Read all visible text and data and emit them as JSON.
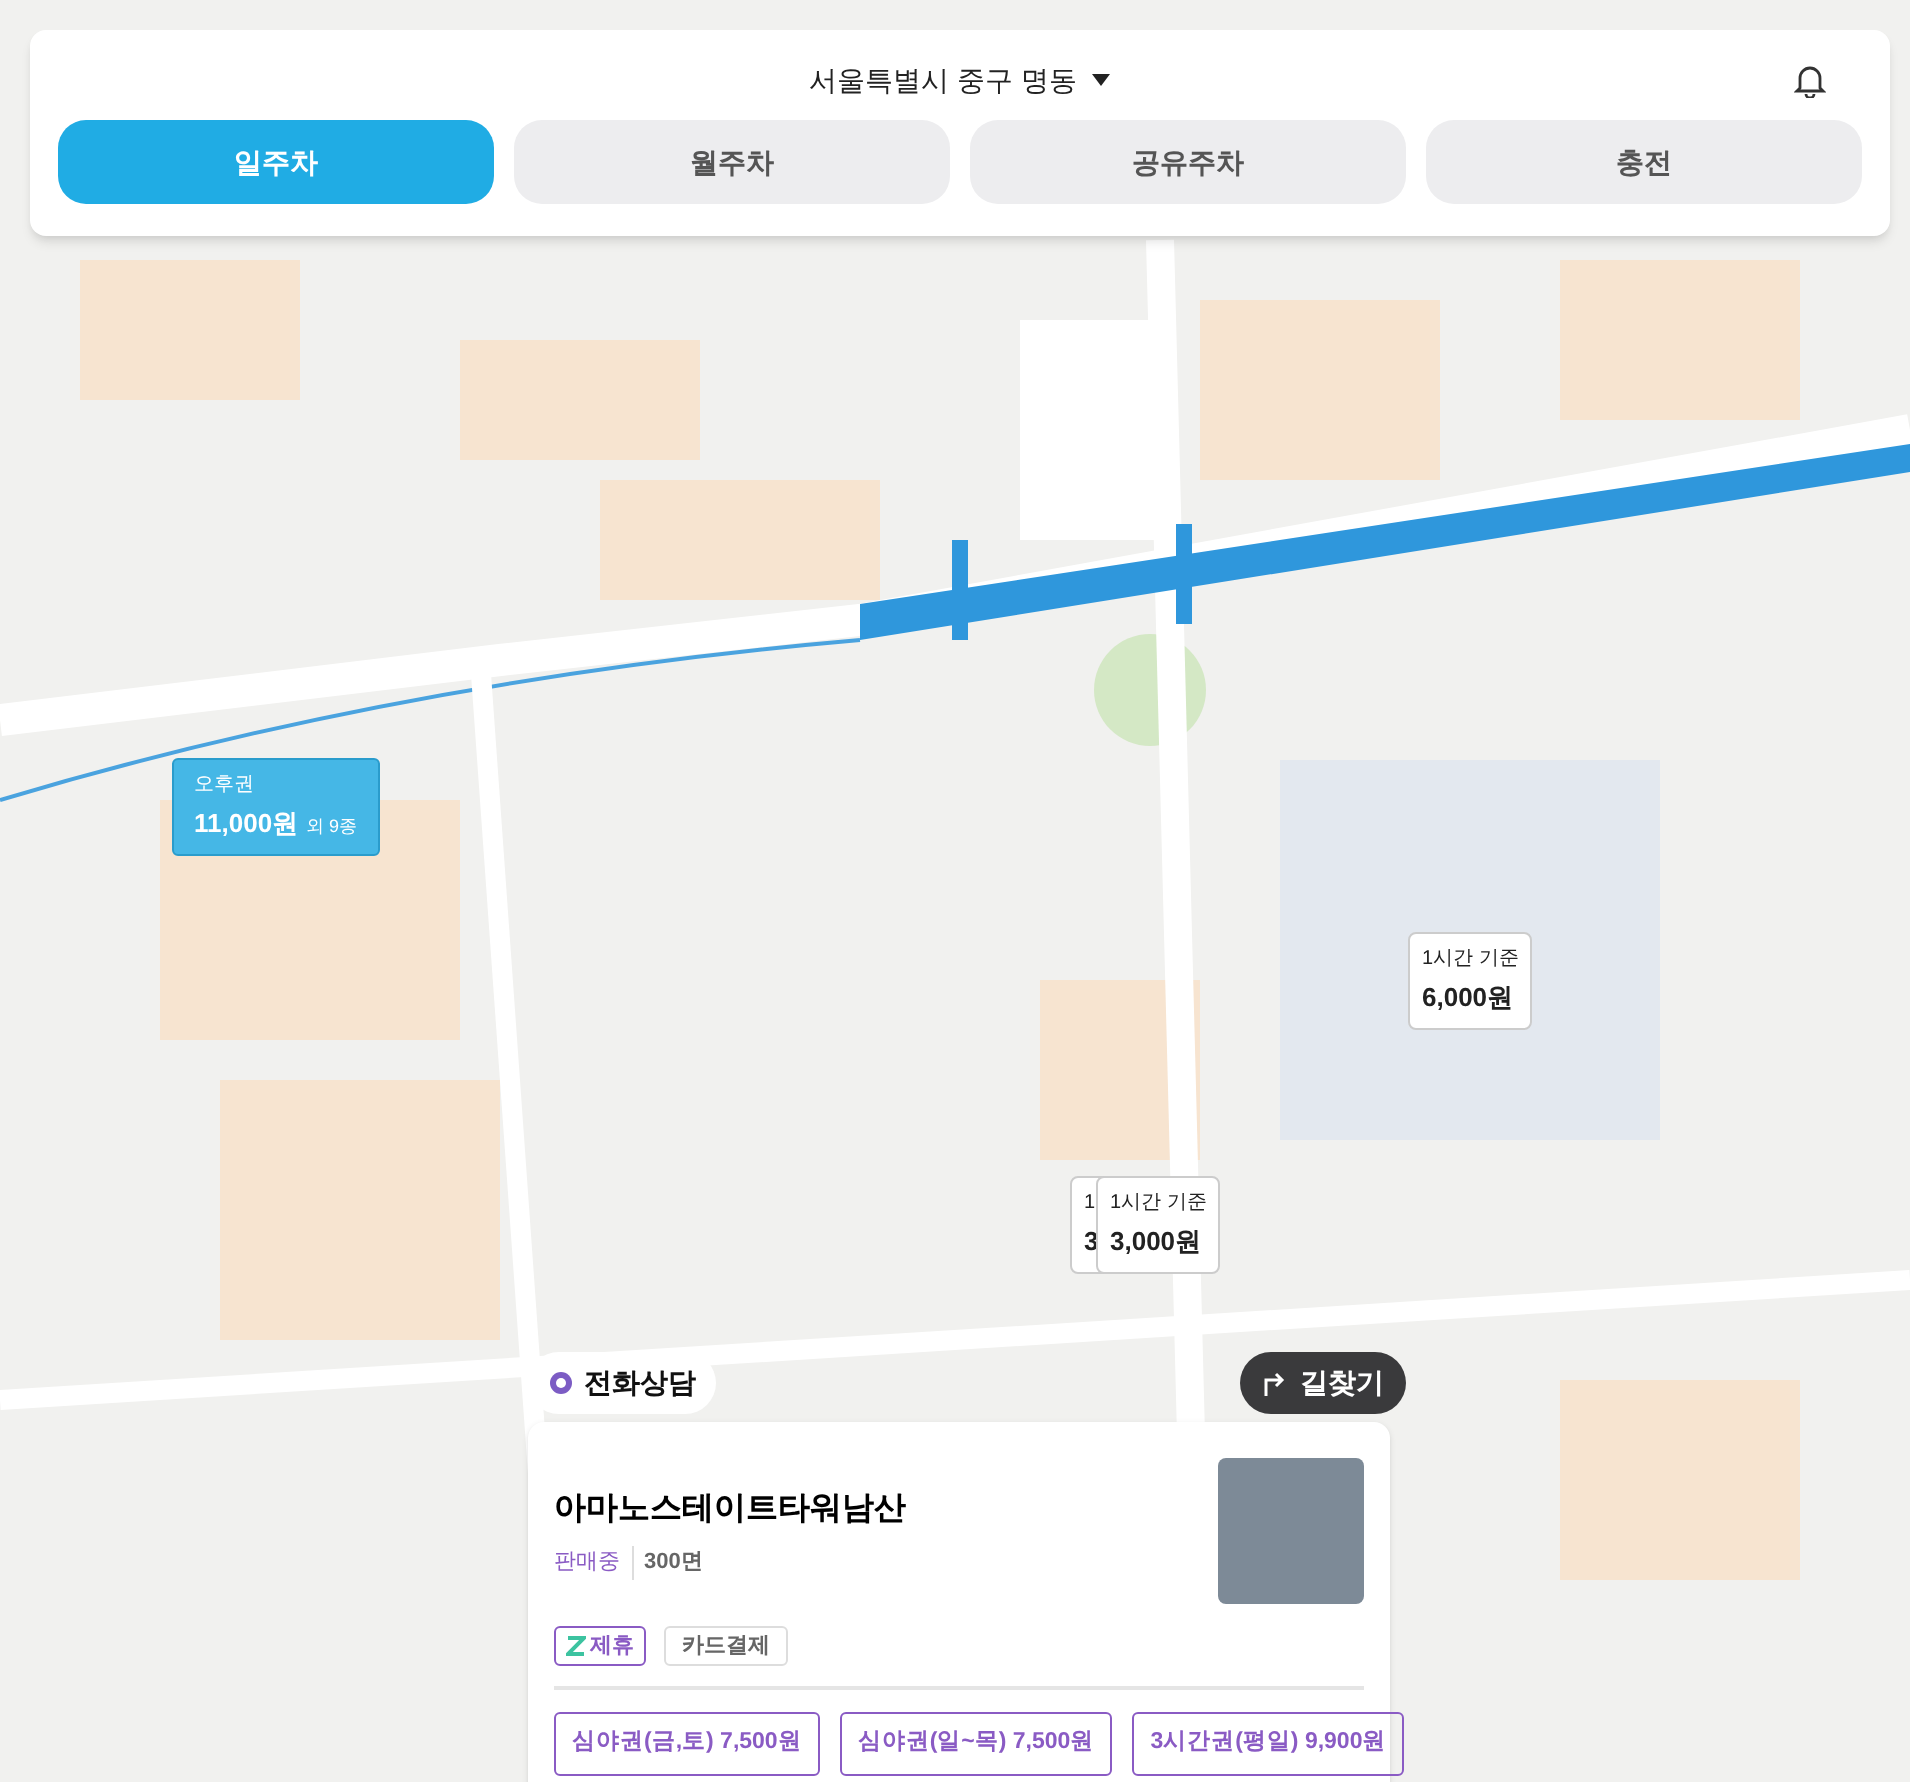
{
  "header": {
    "location": "서울특별시 중구 명동"
  },
  "tabs": [
    {
      "label": "일주차",
      "selected": true
    },
    {
      "label": "월주차",
      "selected": false
    },
    {
      "label": "공유주차",
      "selected": false
    },
    {
      "label": "충전",
      "selected": false
    }
  ],
  "markers": [
    {
      "kind": "highlight",
      "label": "오후권",
      "price": "11,000원",
      "extra": "외 9종"
    },
    {
      "kind": "plain",
      "label": "1시간 기준",
      "price": "6,000원"
    },
    {
      "kind": "plain",
      "label": "1",
      "price": "3"
    },
    {
      "kind": "plain",
      "label": "1시간 기준",
      "price": "3,000원"
    }
  ],
  "actions": {
    "call": "전화상담",
    "directions": "길찾기"
  },
  "lot": {
    "name": "아마노스테이트타워남산",
    "status": "판매중",
    "spaces": "300면",
    "tags": [
      {
        "kind": "partner",
        "label": "제휴"
      },
      {
        "kind": "plain",
        "label": "카드결제"
      }
    ],
    "tickets": [
      "심야권(금,토) 7,500원",
      "심야권(일~목) 7,500원",
      "3시간권(평일) 9,900원"
    ]
  }
}
